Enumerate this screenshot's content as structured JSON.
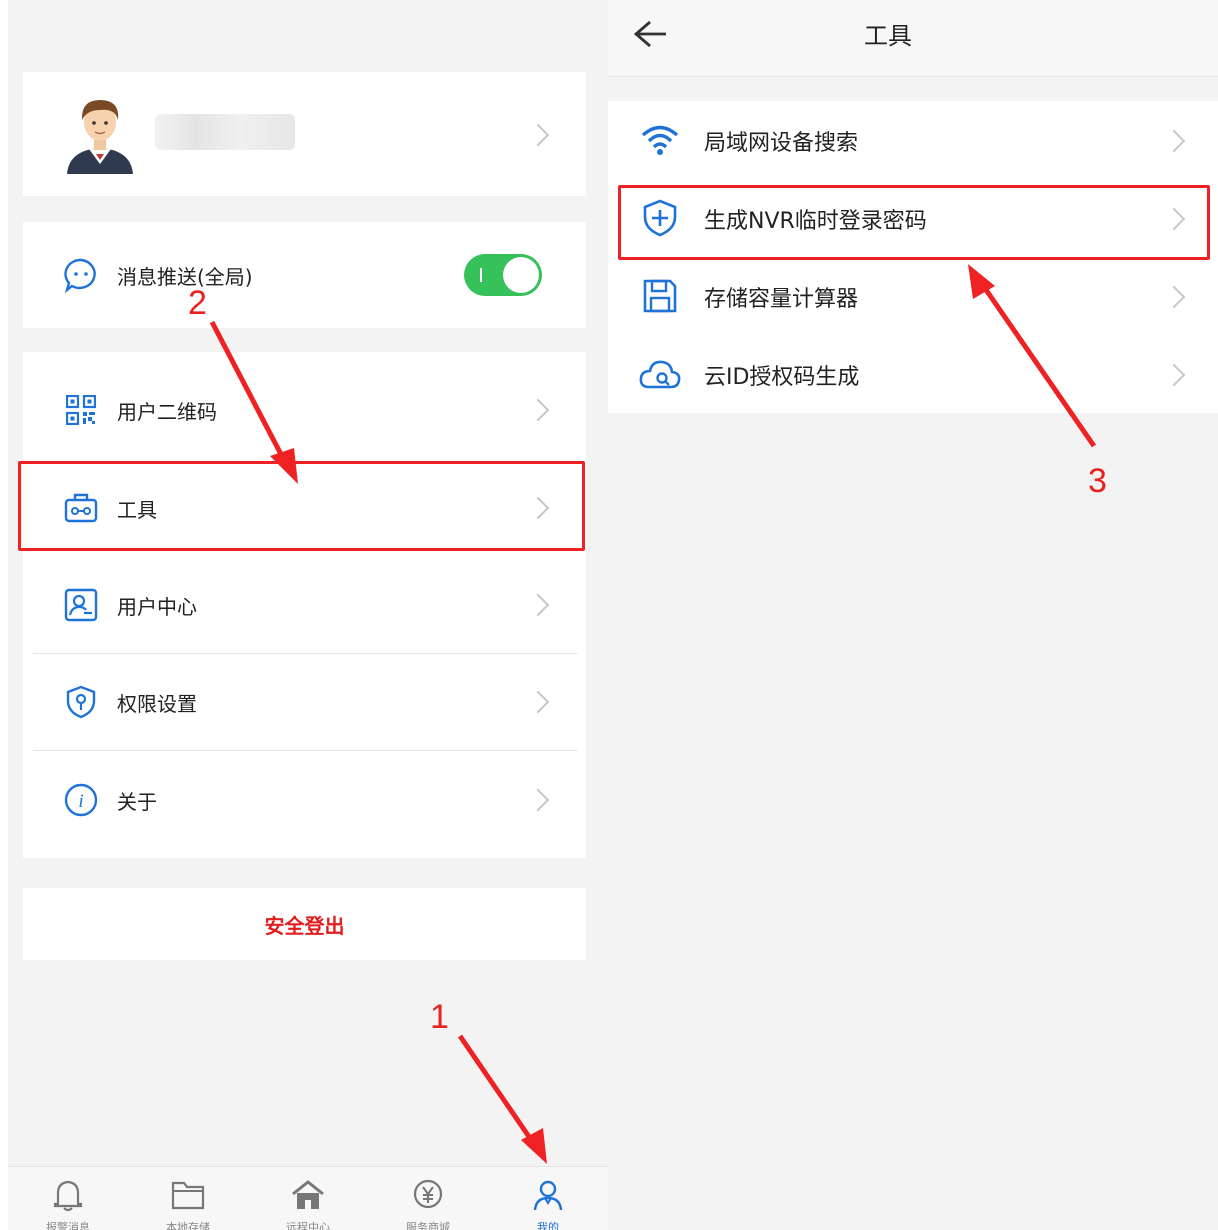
{
  "left": {
    "profile": {
      "name_masked": ""
    },
    "settings": {
      "push_label": "消息推送(全局)",
      "push_enabled": true
    },
    "menu": [
      {
        "label": "用户二维码",
        "icon": "qr-code-icon"
      },
      {
        "label": "工具",
        "icon": "toolbox-icon"
      },
      {
        "label": "用户中心",
        "icon": "user-card-icon"
      },
      {
        "label": "权限设置",
        "icon": "shield-key-icon"
      },
      {
        "label": "关于",
        "icon": "info-icon"
      }
    ],
    "logout_label": "安全登出",
    "tabs": [
      {
        "label": "报警消息",
        "icon": "bell-icon"
      },
      {
        "label": "本地存储",
        "icon": "folder-icon"
      },
      {
        "label": "远程中心",
        "icon": "home-icon"
      },
      {
        "label": "服务商城",
        "icon": "yen-bag-icon"
      },
      {
        "label": "我的",
        "icon": "user-icon",
        "active": true
      }
    ]
  },
  "right": {
    "title": "工具",
    "items": [
      {
        "label": "局域网设备搜索",
        "icon": "wifi-icon"
      },
      {
        "label": "生成NVR临时登录密码",
        "icon": "shield-plus-icon"
      },
      {
        "label": "存储容量计算器",
        "icon": "floppy-disk-icon"
      },
      {
        "label": "云ID授权码生成",
        "icon": "cloud-icon"
      }
    ]
  },
  "annotations": {
    "step1": "1",
    "step2": "2",
    "step3": "3"
  },
  "colors": {
    "accent_blue": "#1e72d8",
    "logout_red": "#e21d1d",
    "annotation_red": "#ee2222",
    "toggle_green": "#36c15a"
  }
}
